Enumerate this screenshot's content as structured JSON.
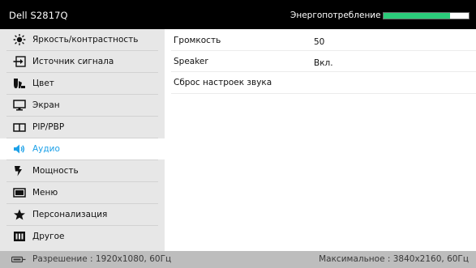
{
  "header": {
    "title": "Dell S2817Q",
    "energy_label": "Энергопотребление",
    "energy_level": 0.78,
    "energy_color": "#2bcb7a"
  },
  "sidebar": {
    "items": [
      {
        "icon": "brightness-contrast-icon",
        "label": "Яркость/контрастность"
      },
      {
        "icon": "input-source-icon",
        "label": "Источник сигнала"
      },
      {
        "icon": "color-icon",
        "label": "Цвет"
      },
      {
        "icon": "display-icon",
        "label": "Экран"
      },
      {
        "icon": "pip-pbp-icon",
        "label": "PIP/PBP"
      },
      {
        "icon": "speaker-icon",
        "label": "Аудио",
        "active": true
      },
      {
        "icon": "power-icon",
        "label": "Мощность"
      },
      {
        "icon": "menu-icon",
        "label": "Меню"
      },
      {
        "icon": "star-icon",
        "label": "Персонализация"
      },
      {
        "icon": "other-icon",
        "label": "Другое"
      }
    ],
    "active_color": "#1da1e8"
  },
  "main": {
    "rows": [
      {
        "label": "Громкость",
        "value": "50"
      },
      {
        "label": "Speaker",
        "value": "Вкл."
      },
      {
        "label": "Сброс настроек звука",
        "value": ""
      }
    ]
  },
  "footer": {
    "icon": "cable-icon",
    "resolution": "Разрешение : 1920x1080, 60Гц",
    "max_resolution": "Максимальное : 3840x2160, 60Гц"
  }
}
